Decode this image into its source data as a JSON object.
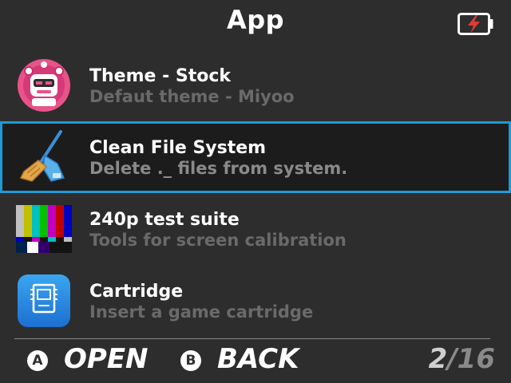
{
  "header": {
    "title": "App"
  },
  "status": {
    "battery_state": "charging",
    "battery_icon": "battery-charging-icon"
  },
  "list": {
    "items": [
      {
        "name": "Theme - Stock",
        "desc": "Defaut theme - Miyoo",
        "icon": "theme-robot-icon",
        "selected": false
      },
      {
        "name": "Clean File System",
        "desc": "Delete ._ files from system.",
        "icon": "broom-dustpan-icon",
        "selected": true
      },
      {
        "name": "240p test suite",
        "desc": "Tools for screen calibration",
        "icon": "color-bars-icon",
        "selected": false
      },
      {
        "name": "Cartridge",
        "desc": "Insert a game cartridge",
        "icon": "cartridge-icon",
        "selected": false
      }
    ]
  },
  "footer": {
    "a_glyph": "A",
    "a_label": "OPEN",
    "b_glyph": "B",
    "b_label": "BACK",
    "page_current": "2",
    "page_separator": "/",
    "page_total": "16"
  },
  "colors": {
    "background": "#2d2d2d",
    "selection_border": "#1e9ad6",
    "secondary_text": "#6a6a6a"
  }
}
